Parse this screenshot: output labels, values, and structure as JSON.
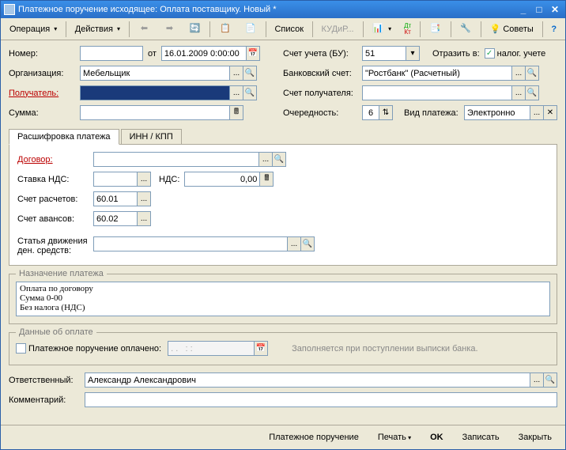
{
  "window": {
    "title": "Платежное поручение исходящее: Оплата поставщику. Новый *"
  },
  "toolbar": {
    "operation": "Операция",
    "actions": "Действия",
    "list": "Список",
    "kudip": "КУДиР...",
    "tips": "Советы"
  },
  "header": {
    "number_lbl": "Номер:",
    "from_lbl": "от",
    "date": "16.01.2009 0:00:00",
    "org_lbl": "Организация:",
    "org": "Мебельщик",
    "recipient_lbl": "Получатель:",
    "recipient": "",
    "sum_lbl": "Сумма:",
    "sum": "",
    "account_bu_lbl": "Счет учета (БУ):",
    "account_bu": "51",
    "reflect_lbl": "Отразить в:",
    "tax_accounting": "налог. учете",
    "bank_acc_lbl": "Банковский счет:",
    "bank_acc": "\"Ростбанк\" (Расчетный)",
    "recipient_acc_lbl": "Счет получателя:",
    "priority_lbl": "Очередность:",
    "priority": "6",
    "pay_type_lbl": "Вид платежа:",
    "pay_type": "Электронно"
  },
  "tabs": {
    "t1": "Расшифровка платежа",
    "t2": "ИНН / КПП"
  },
  "detail": {
    "contract_lbl": "Договор:",
    "vat_rate_lbl": "Ставка НДС:",
    "vat_lbl": "НДС:",
    "vat_val": "0,00",
    "settle_acc_lbl": "Счет расчетов:",
    "settle_acc": "60.01",
    "advance_acc_lbl": "Счет авансов:",
    "advance_acc": "60.02",
    "ddv_lbl1": "Статья движения",
    "ddv_lbl2": "ден. средств:"
  },
  "purpose": {
    "legend": "Назначение платежа",
    "text": "Оплата по договору\nСумма 0-00\nБез налога (НДС)"
  },
  "payinfo": {
    "legend": "Данные об оплате",
    "paid_lbl": "Платежное поручение оплачено:",
    "paid_date": ". .   : :",
    "hint": "Заполняется при поступлении выписки банка."
  },
  "bottom": {
    "resp_lbl": "Ответственный:",
    "resp": "Александр Александрович",
    "comment_lbl": "Комментарий:"
  },
  "footer": {
    "payorder": "Платежное поручение",
    "print": "Печать",
    "ok": "OK",
    "save": "Записать",
    "close": "Закрыть"
  }
}
